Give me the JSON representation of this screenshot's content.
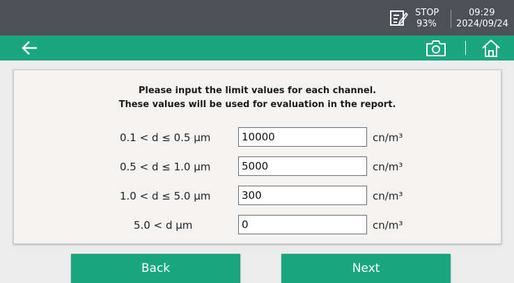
{
  "status": {
    "stop_label": "STOP",
    "battery": "93%",
    "time": "09:29",
    "date": "2024/09/24"
  },
  "icons": {
    "back": "arrow-left-icon",
    "camera": "camera-icon",
    "home": "home-icon",
    "record": "edit-note-icon"
  },
  "panel": {
    "instruction_line1": "Please input the limit values for each channel.",
    "instruction_line2": "These values will be used for evaluation in the report.",
    "rows": [
      {
        "label": "0.1 < d ≤ 0.5 µm",
        "value": "10000",
        "unit": "cn/m³"
      },
      {
        "label": "0.5 < d ≤ 1.0 µm",
        "value": "5000",
        "unit": "cn/m³"
      },
      {
        "label": "1.0 < d ≤ 5.0 µm",
        "value": "300",
        "unit": "cn/m³"
      },
      {
        "label": "5.0 < d µm",
        "value": "0",
        "unit": "cn/m³"
      }
    ]
  },
  "buttons": {
    "back": "Back",
    "next": "Next"
  },
  "colors": {
    "accent": "#1aa67f",
    "statusbar": "#4d5056"
  }
}
